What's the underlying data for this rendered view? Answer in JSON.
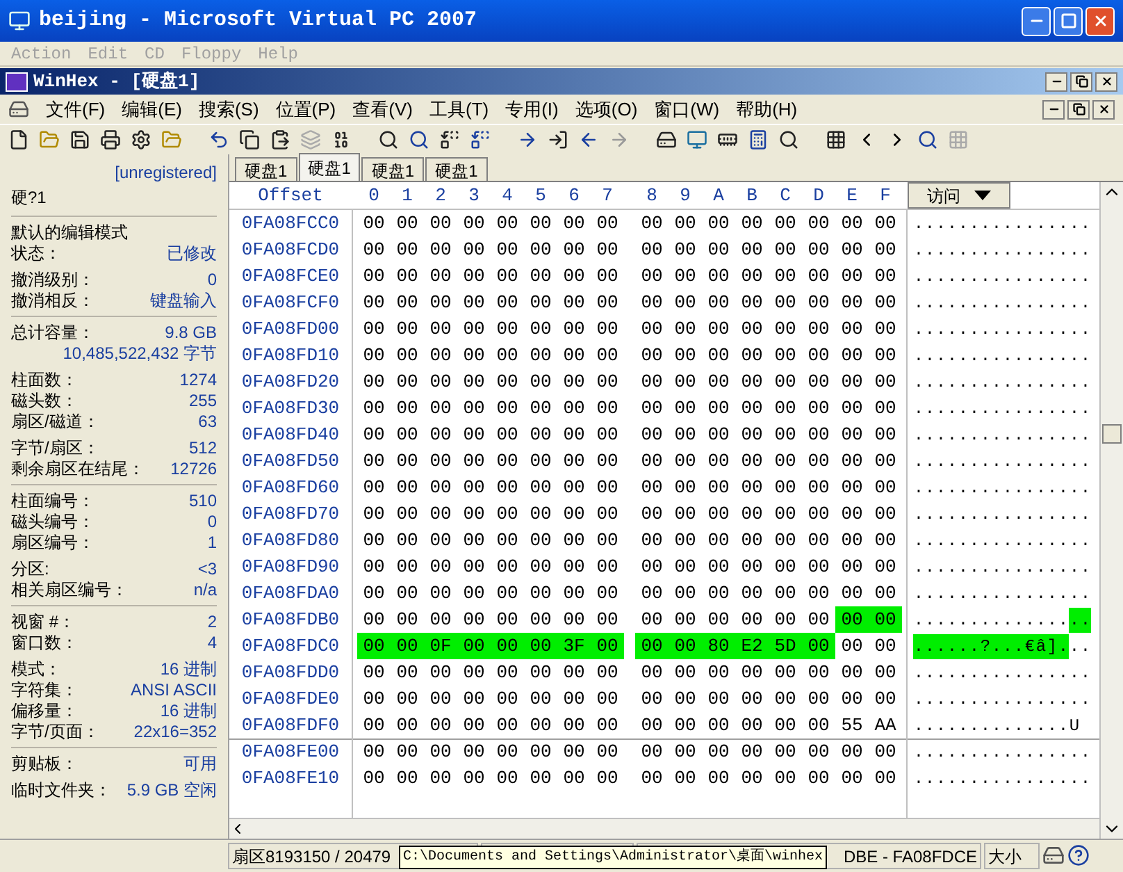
{
  "host_window": {
    "title": "beijing - Microsoft Virtual PC 2007",
    "menu": [
      "Action",
      "Edit",
      "CD",
      "Floppy",
      "Help"
    ]
  },
  "app_window": {
    "title": "WinHex - [硬盘1]"
  },
  "menu": [
    "文件(F)",
    "编辑(E)",
    "搜索(S)",
    "位置(P)",
    "查看(V)",
    "工具(T)",
    "专用(I)",
    "选项(O)",
    "窗口(W)",
    "帮助(H)"
  ],
  "info_panel": {
    "registration": "[unregistered]",
    "disk": "硬?1",
    "sections": [
      {
        "groups": [
          [
            {
              "label": "默认的编辑模式"
            },
            {
              "label": "状态：",
              "value": "已修改"
            }
          ],
          [
            {
              "label": "撤消级别：",
              "value": "0"
            },
            {
              "label": "撤消相反：",
              "value": "键盘输入"
            }
          ]
        ]
      },
      {
        "groups": [
          [
            {
              "label": "总计容量：",
              "value": "9.8 GB"
            },
            {
              "value": "10,485,522,432 字节"
            }
          ],
          [
            {
              "label": "柱面数：",
              "value": "1274"
            },
            {
              "label": "磁头数：",
              "value": "255"
            },
            {
              "label": "扇区/磁道：",
              "value": "63"
            }
          ],
          [
            {
              "label": "字节/扇区：",
              "value": "512"
            },
            {
              "label": "剩余扇区在结尾：",
              "value": "12726"
            }
          ]
        ]
      },
      {
        "groups": [
          [
            {
              "label": "柱面编号：",
              "value": "510"
            },
            {
              "label": "磁头编号：",
              "value": "0"
            },
            {
              "label": "扇区编号：",
              "value": "1"
            }
          ],
          [
            {
              "label": "分区:",
              "value": "<3"
            },
            {
              "label": "相关扇区编号：",
              "value": "n/a"
            }
          ]
        ]
      },
      {
        "groups": [
          [
            {
              "label": "视窗 #：",
              "value": "2"
            },
            {
              "label": "窗口数：",
              "value": "4"
            }
          ],
          [
            {
              "label": "模式：",
              "value": "16 进制"
            },
            {
              "label": "字符集：",
              "value": "ANSI ASCII"
            },
            {
              "label": "偏移量：",
              "value": "16 进制"
            },
            {
              "label": "字节/页面：",
              "value": "22x16=352"
            }
          ]
        ]
      },
      {
        "groups": [
          [
            {
              "label": "剪贴板：",
              "value": "可用"
            }
          ],
          [
            {
              "label": "临时文件夹：",
              "value": "5.9 GB 空闲"
            }
          ]
        ]
      }
    ]
  },
  "tabs": [
    {
      "label": "硬盘1",
      "selected": false
    },
    {
      "label": "硬盘1",
      "selected": true
    },
    {
      "label": "硬盘1",
      "selected": false
    },
    {
      "label": "硬盘1",
      "selected": false
    }
  ],
  "hex": {
    "offset_header": "Offset",
    "columns": [
      "0",
      "1",
      "2",
      "3",
      "4",
      "5",
      "6",
      "7",
      "8",
      "9",
      "A",
      "B",
      "C",
      "D",
      "E",
      "F"
    ],
    "ascii_header": "访问",
    "rows": [
      {
        "offset": "0FA08FCC0",
        "bytes": [
          "00",
          "00",
          "00",
          "00",
          "00",
          "00",
          "00",
          "00",
          "00",
          "00",
          "00",
          "00",
          "00",
          "00",
          "00",
          "00"
        ],
        "selected": [
          false,
          false,
          false,
          false,
          false,
          false,
          false,
          false,
          false,
          false,
          false,
          false,
          false,
          false,
          false,
          false
        ],
        "ascii": "................",
        "sector_start": false
      },
      {
        "offset": "0FA08FCD0",
        "bytes": [
          "00",
          "00",
          "00",
          "00",
          "00",
          "00",
          "00",
          "00",
          "00",
          "00",
          "00",
          "00",
          "00",
          "00",
          "00",
          "00"
        ],
        "selected": [
          false,
          false,
          false,
          false,
          false,
          false,
          false,
          false,
          false,
          false,
          false,
          false,
          false,
          false,
          false,
          false
        ],
        "ascii": "................",
        "sector_start": false
      },
      {
        "offset": "0FA08FCE0",
        "bytes": [
          "00",
          "00",
          "00",
          "00",
          "00",
          "00",
          "00",
          "00",
          "00",
          "00",
          "00",
          "00",
          "00",
          "00",
          "00",
          "00"
        ],
        "selected": [
          false,
          false,
          false,
          false,
          false,
          false,
          false,
          false,
          false,
          false,
          false,
          false,
          false,
          false,
          false,
          false
        ],
        "ascii": "................",
        "sector_start": false
      },
      {
        "offset": "0FA08FCF0",
        "bytes": [
          "00",
          "00",
          "00",
          "00",
          "00",
          "00",
          "00",
          "00",
          "00",
          "00",
          "00",
          "00",
          "00",
          "00",
          "00",
          "00"
        ],
        "selected": [
          false,
          false,
          false,
          false,
          false,
          false,
          false,
          false,
          false,
          false,
          false,
          false,
          false,
          false,
          false,
          false
        ],
        "ascii": "................",
        "sector_start": false
      },
      {
        "offset": "0FA08FD00",
        "bytes": [
          "00",
          "00",
          "00",
          "00",
          "00",
          "00",
          "00",
          "00",
          "00",
          "00",
          "00",
          "00",
          "00",
          "00",
          "00",
          "00"
        ],
        "selected": [
          false,
          false,
          false,
          false,
          false,
          false,
          false,
          false,
          false,
          false,
          false,
          false,
          false,
          false,
          false,
          false
        ],
        "ascii": "................",
        "sector_start": false
      },
      {
        "offset": "0FA08FD10",
        "bytes": [
          "00",
          "00",
          "00",
          "00",
          "00",
          "00",
          "00",
          "00",
          "00",
          "00",
          "00",
          "00",
          "00",
          "00",
          "00",
          "00"
        ],
        "selected": [
          false,
          false,
          false,
          false,
          false,
          false,
          false,
          false,
          false,
          false,
          false,
          false,
          false,
          false,
          false,
          false
        ],
        "ascii": "................",
        "sector_start": false
      },
      {
        "offset": "0FA08FD20",
        "bytes": [
          "00",
          "00",
          "00",
          "00",
          "00",
          "00",
          "00",
          "00",
          "00",
          "00",
          "00",
          "00",
          "00",
          "00",
          "00",
          "00"
        ],
        "selected": [
          false,
          false,
          false,
          false,
          false,
          false,
          false,
          false,
          false,
          false,
          false,
          false,
          false,
          false,
          false,
          false
        ],
        "ascii": "................",
        "sector_start": false
      },
      {
        "offset": "0FA08FD30",
        "bytes": [
          "00",
          "00",
          "00",
          "00",
          "00",
          "00",
          "00",
          "00",
          "00",
          "00",
          "00",
          "00",
          "00",
          "00",
          "00",
          "00"
        ],
        "selected": [
          false,
          false,
          false,
          false,
          false,
          false,
          false,
          false,
          false,
          false,
          false,
          false,
          false,
          false,
          false,
          false
        ],
        "ascii": "................",
        "sector_start": false
      },
      {
        "offset": "0FA08FD40",
        "bytes": [
          "00",
          "00",
          "00",
          "00",
          "00",
          "00",
          "00",
          "00",
          "00",
          "00",
          "00",
          "00",
          "00",
          "00",
          "00",
          "00"
        ],
        "selected": [
          false,
          false,
          false,
          false,
          false,
          false,
          false,
          false,
          false,
          false,
          false,
          false,
          false,
          false,
          false,
          false
        ],
        "ascii": "................",
        "sector_start": false
      },
      {
        "offset": "0FA08FD50",
        "bytes": [
          "00",
          "00",
          "00",
          "00",
          "00",
          "00",
          "00",
          "00",
          "00",
          "00",
          "00",
          "00",
          "00",
          "00",
          "00",
          "00"
        ],
        "selected": [
          false,
          false,
          false,
          false,
          false,
          false,
          false,
          false,
          false,
          false,
          false,
          false,
          false,
          false,
          false,
          false
        ],
        "ascii": "................",
        "sector_start": false
      },
      {
        "offset": "0FA08FD60",
        "bytes": [
          "00",
          "00",
          "00",
          "00",
          "00",
          "00",
          "00",
          "00",
          "00",
          "00",
          "00",
          "00",
          "00",
          "00",
          "00",
          "00"
        ],
        "selected": [
          false,
          false,
          false,
          false,
          false,
          false,
          false,
          false,
          false,
          false,
          false,
          false,
          false,
          false,
          false,
          false
        ],
        "ascii": "................",
        "sector_start": false
      },
      {
        "offset": "0FA08FD70",
        "bytes": [
          "00",
          "00",
          "00",
          "00",
          "00",
          "00",
          "00",
          "00",
          "00",
          "00",
          "00",
          "00",
          "00",
          "00",
          "00",
          "00"
        ],
        "selected": [
          false,
          false,
          false,
          false,
          false,
          false,
          false,
          false,
          false,
          false,
          false,
          false,
          false,
          false,
          false,
          false
        ],
        "ascii": "................",
        "sector_start": false
      },
      {
        "offset": "0FA08FD80",
        "bytes": [
          "00",
          "00",
          "00",
          "00",
          "00",
          "00",
          "00",
          "00",
          "00",
          "00",
          "00",
          "00",
          "00",
          "00",
          "00",
          "00"
        ],
        "selected": [
          false,
          false,
          false,
          false,
          false,
          false,
          false,
          false,
          false,
          false,
          false,
          false,
          false,
          false,
          false,
          false
        ],
        "ascii": "................",
        "sector_start": false
      },
      {
        "offset": "0FA08FD90",
        "bytes": [
          "00",
          "00",
          "00",
          "00",
          "00",
          "00",
          "00",
          "00",
          "00",
          "00",
          "00",
          "00",
          "00",
          "00",
          "00",
          "00"
        ],
        "selected": [
          false,
          false,
          false,
          false,
          false,
          false,
          false,
          false,
          false,
          false,
          false,
          false,
          false,
          false,
          false,
          false
        ],
        "ascii": "................",
        "sector_start": false
      },
      {
        "offset": "0FA08FDA0",
        "bytes": [
          "00",
          "00",
          "00",
          "00",
          "00",
          "00",
          "00",
          "00",
          "00",
          "00",
          "00",
          "00",
          "00",
          "00",
          "00",
          "00"
        ],
        "selected": [
          false,
          false,
          false,
          false,
          false,
          false,
          false,
          false,
          false,
          false,
          false,
          false,
          false,
          false,
          false,
          false
        ],
        "ascii": "................",
        "sector_start": false
      },
      {
        "offset": "0FA08FDB0",
        "bytes": [
          "00",
          "00",
          "00",
          "00",
          "00",
          "00",
          "00",
          "00",
          "00",
          "00",
          "00",
          "00",
          "00",
          "00",
          "00",
          "00"
        ],
        "selected": [
          false,
          false,
          false,
          false,
          false,
          false,
          false,
          false,
          false,
          false,
          false,
          false,
          false,
          false,
          true,
          true
        ],
        "ascii": "................",
        "sector_start": false
      },
      {
        "offset": "0FA08FDC0",
        "bytes": [
          "00",
          "00",
          "0F",
          "00",
          "00",
          "00",
          "3F",
          "00",
          "00",
          "00",
          "80",
          "E2",
          "5D",
          "00",
          "00",
          "00"
        ],
        "selected": [
          true,
          true,
          true,
          true,
          true,
          true,
          true,
          true,
          true,
          true,
          true,
          true,
          true,
          true,
          false,
          false
        ],
        "ascii": "......?...€â]...",
        "sector_start": false
      },
      {
        "offset": "0FA08FDD0",
        "bytes": [
          "00",
          "00",
          "00",
          "00",
          "00",
          "00",
          "00",
          "00",
          "00",
          "00",
          "00",
          "00",
          "00",
          "00",
          "00",
          "00"
        ],
        "selected": [
          false,
          false,
          false,
          false,
          false,
          false,
          false,
          false,
          false,
          false,
          false,
          false,
          false,
          false,
          false,
          false
        ],
        "ascii": "................",
        "sector_start": false
      },
      {
        "offset": "0FA08FDE0",
        "bytes": [
          "00",
          "00",
          "00",
          "00",
          "00",
          "00",
          "00",
          "00",
          "00",
          "00",
          "00",
          "00",
          "00",
          "00",
          "00",
          "00"
        ],
        "selected": [
          false,
          false,
          false,
          false,
          false,
          false,
          false,
          false,
          false,
          false,
          false,
          false,
          false,
          false,
          false,
          false
        ],
        "ascii": "................",
        "sector_start": false
      },
      {
        "offset": "0FA08FDF0",
        "bytes": [
          "00",
          "00",
          "00",
          "00",
          "00",
          "00",
          "00",
          "00",
          "00",
          "00",
          "00",
          "00",
          "00",
          "00",
          "55",
          "AA"
        ],
        "selected": [
          false,
          false,
          false,
          false,
          false,
          false,
          false,
          false,
          false,
          false,
          false,
          false,
          false,
          false,
          false,
          false
        ],
        "ascii": "..............U",
        "sector_start": false
      },
      {
        "offset": "0FA08FE00",
        "bytes": [
          "00",
          "00",
          "00",
          "00",
          "00",
          "00",
          "00",
          "00",
          "00",
          "00",
          "00",
          "00",
          "00",
          "00",
          "00",
          "00"
        ],
        "selected": [
          false,
          false,
          false,
          false,
          false,
          false,
          false,
          false,
          false,
          false,
          false,
          false,
          false,
          false,
          false,
          false
        ],
        "ascii": "................",
        "sector_start": true
      },
      {
        "offset": "0FA08FE10",
        "bytes": [
          "00",
          "00",
          "00",
          "00",
          "00",
          "00",
          "00",
          "00",
          "00",
          "00",
          "00",
          "00",
          "00",
          "00",
          "00",
          "00"
        ],
        "selected": [
          false,
          false,
          false,
          false,
          false,
          false,
          false,
          false,
          false,
          false,
          false,
          false,
          false,
          false,
          false,
          false
        ],
        "ascii": "................",
        "sector_start": false
      }
    ]
  },
  "status_bar": [
    "扇区8193150 / 20479",
    "DBE - FA08FDCE",
    "大小"
  ],
  "tooltip": "C:\\Documents and Settings\\Administrator\\桌面\\winhex"
}
